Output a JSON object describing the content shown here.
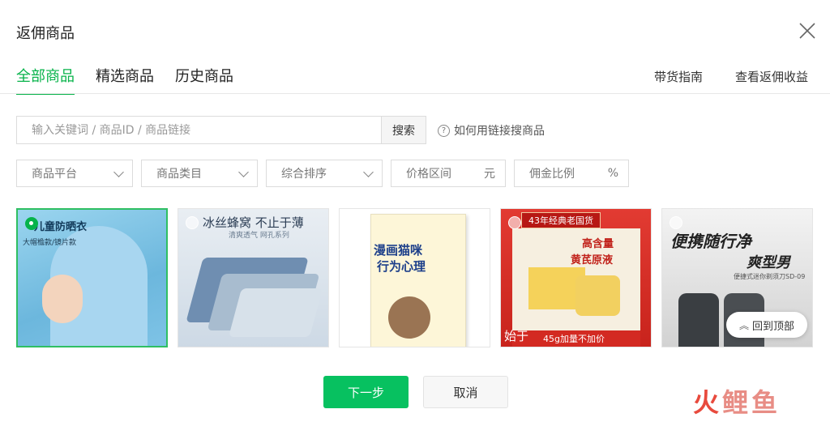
{
  "dialog": {
    "title": "返佣商品"
  },
  "tabs": [
    {
      "label": "全部商品",
      "active": true
    },
    {
      "label": "精选商品",
      "active": false
    },
    {
      "label": "历史商品",
      "active": false
    }
  ],
  "header_links": {
    "guide": "带货指南",
    "earnings": "查看返佣收益"
  },
  "search": {
    "placeholder": "输入关键词 / 商品ID / 商品链接",
    "value": "",
    "button_label": "搜索",
    "help_text": "如何用链接搜商品"
  },
  "filters": {
    "platform": "商品平台",
    "category": "商品类目",
    "sort": "综合排序",
    "price": {
      "label": "价格区间",
      "unit": "元"
    },
    "commission": {
      "label": "佣金比例",
      "unit": "%"
    }
  },
  "products": [
    {
      "selected": true,
      "texts": [
        "儿童防晒衣",
        "大帽檐款/镜片款"
      ]
    },
    {
      "selected": false,
      "texts": [
        "冰丝蜂窝 不止于薄",
        "清爽透气 网孔系列"
      ]
    },
    {
      "selected": false,
      "texts": [
        "漫画猫咪",
        "行为心理"
      ]
    },
    {
      "selected": false,
      "texts": [
        "43年经典老国货",
        "高含量",
        "黄芪原液",
        "45g加量不加价",
        "始于"
      ]
    },
    {
      "selected": false,
      "texts": [
        "便携随行净",
        "爽型男",
        "便捷式迷你剃须刀SD-09"
      ]
    }
  ],
  "back_to_top": "回到顶部",
  "buttons": {
    "next": "下一步",
    "cancel": "取消"
  },
  "watermark": {
    "first": "火",
    "rest": "鲤鱼"
  },
  "colors": {
    "accent": "#07c160",
    "tab_active": "#07b34a"
  }
}
